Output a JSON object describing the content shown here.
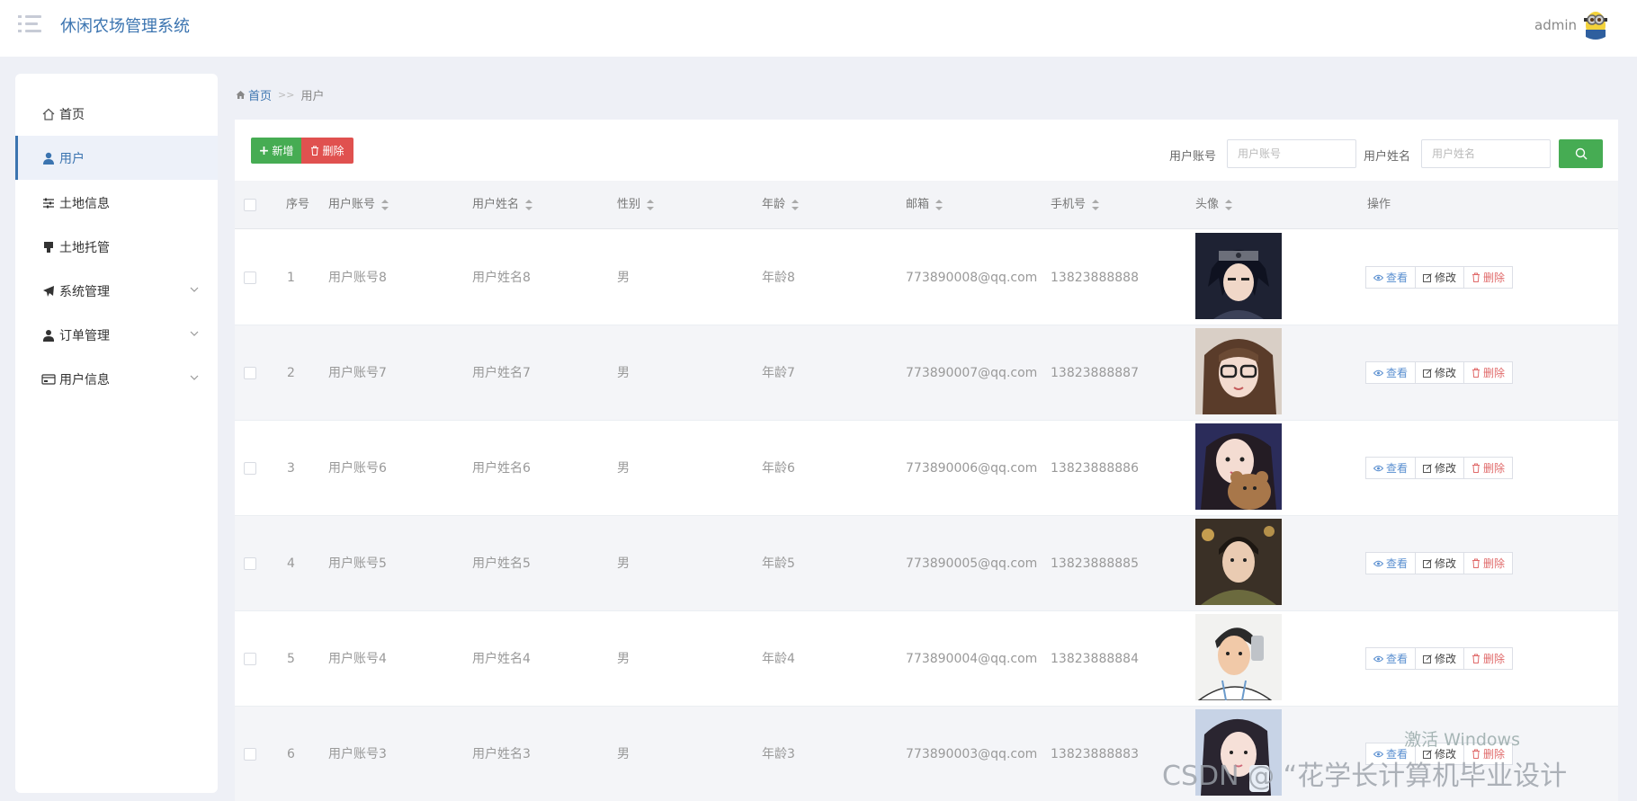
{
  "header": {
    "title": "休闲农场管理系统",
    "username": "admin"
  },
  "sidebar": {
    "items": [
      {
        "label": "首页",
        "icon": "home-icon",
        "active": false
      },
      {
        "label": "用户",
        "icon": "user-icon",
        "active": true
      },
      {
        "label": "土地信息",
        "icon": "sliders-icon",
        "active": false
      },
      {
        "label": "土地托管",
        "icon": "stamp-icon",
        "active": false
      },
      {
        "label": "系统管理",
        "icon": "paper-plane-icon",
        "active": false,
        "expandable": true
      },
      {
        "label": "订单管理",
        "icon": "user-silhouette-icon",
        "active": false,
        "expandable": true
      },
      {
        "label": "用户信息",
        "icon": "card-icon",
        "active": false,
        "expandable": true
      }
    ]
  },
  "breadcrumb": {
    "home": "首页",
    "separator": ">>",
    "current": "用户"
  },
  "toolbar": {
    "add_label": "新增",
    "delete_label": "删除"
  },
  "filters": {
    "account_label": "用户账号",
    "account_placeholder": "用户账号",
    "name_label": "用户姓名",
    "name_placeholder": "用户姓名"
  },
  "table": {
    "headers": {
      "index": "序号",
      "account": "用户账号",
      "name": "用户姓名",
      "gender": "性别",
      "age": "年龄",
      "email": "邮箱",
      "phone": "手机号",
      "avatar": "头像",
      "actions": "操作"
    },
    "rows": [
      {
        "index": "1",
        "account": "用户账号8",
        "name": "用户姓名8",
        "gender": "男",
        "age": "年龄8",
        "email": "773890008@qq.com",
        "phone": "13823888888"
      },
      {
        "index": "2",
        "account": "用户账号7",
        "name": "用户姓名7",
        "gender": "男",
        "age": "年龄7",
        "email": "773890007@qq.com",
        "phone": "13823888887"
      },
      {
        "index": "3",
        "account": "用户账号6",
        "name": "用户姓名6",
        "gender": "男",
        "age": "年龄6",
        "email": "773890006@qq.com",
        "phone": "13823888886"
      },
      {
        "index": "4",
        "account": "用户账号5",
        "name": "用户姓名5",
        "gender": "男",
        "age": "年龄5",
        "email": "773890005@qq.com",
        "phone": "13823888885"
      },
      {
        "index": "5",
        "account": "用户账号4",
        "name": "用户姓名4",
        "gender": "男",
        "age": "年龄4",
        "email": "773890004@qq.com",
        "phone": "13823888884"
      },
      {
        "index": "6",
        "account": "用户账号3",
        "name": "用户姓名3",
        "gender": "男",
        "age": "年龄3",
        "email": "773890003@qq.com",
        "phone": "13823888883"
      }
    ],
    "actions": {
      "view": "查看",
      "edit": "修改",
      "delete": "删除"
    }
  },
  "overlay": {
    "watermark": "激活 Windows",
    "credit": "CSDN @ “花学长计算机毕业设计"
  },
  "colors": {
    "accent": "#3b74b0",
    "add": "#46ac53",
    "danger": "#e0514f"
  }
}
